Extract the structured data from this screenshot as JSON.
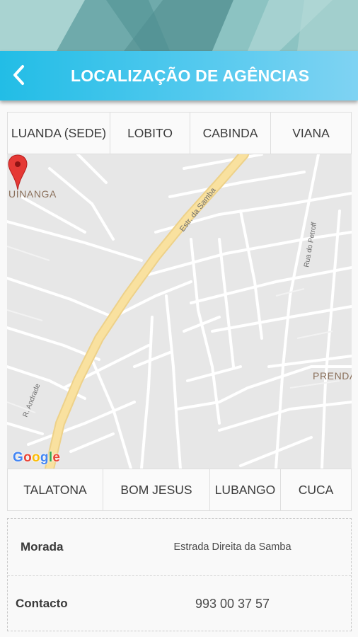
{
  "header": {
    "title": "LOCALIZAÇÃO DE AGÊNCIAS",
    "back_icon": "chevron-left-icon"
  },
  "tabs_top": [
    "LUANDA (SEDE)",
    "LOBITO",
    "CABINDA",
    "VIANA"
  ],
  "tabs_bottom": [
    "TALATONA",
    "BOM JESUS",
    "LUBANGO",
    "CUCA"
  ],
  "map": {
    "labels": {
      "area_1": "UINANGA",
      "area_2": "PRENDA",
      "road_main": "Estr. da Samba",
      "road_2": "Rua do Petroff",
      "road_3": "R. Andrade"
    },
    "google_logo": [
      "G",
      "o",
      "o",
      "g",
      "l",
      "e"
    ],
    "logo_colors": [
      "#4285F4",
      "#EA4335",
      "#FBBC05",
      "#4285F4",
      "#34A853",
      "#EA4335"
    ],
    "pin_color": "#e53935"
  },
  "details": {
    "address_label": "Morada",
    "address_value": "Estrada Direita da Samba",
    "contact_label": "Contacto",
    "contact_value": "993 00 37 57"
  },
  "colors": {
    "header_start": "#22bde6",
    "header_end": "#7fd3f3",
    "road_major": "#f8e09a"
  }
}
